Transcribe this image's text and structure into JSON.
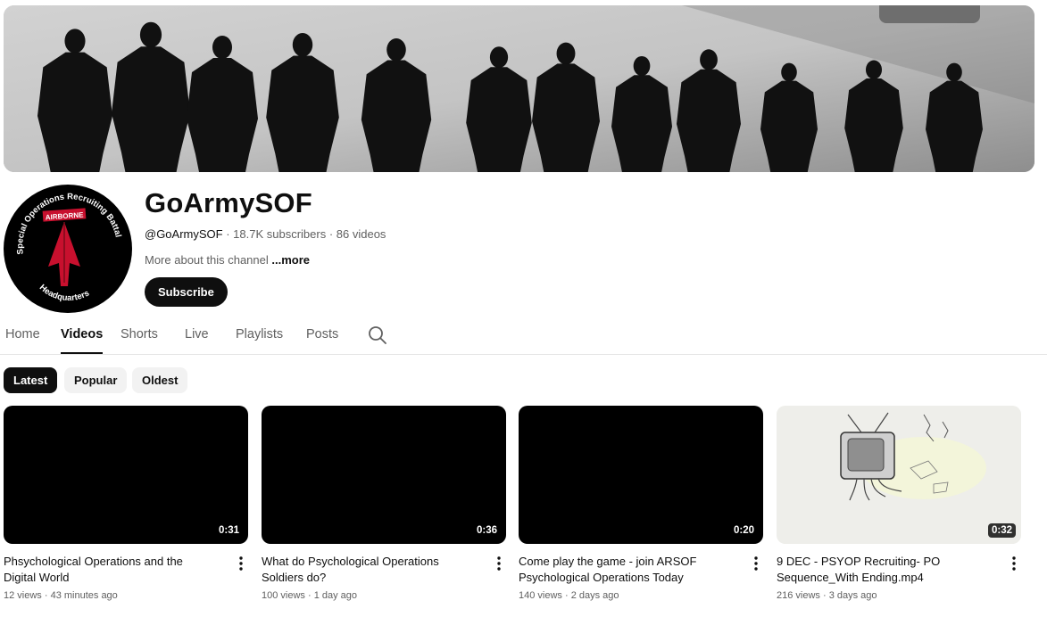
{
  "channel": {
    "name": "GoArmySOF",
    "handle": "@GoArmySOF",
    "subscribers": "18.7K subscribers",
    "video_count": "86 videos",
    "separator": " · ",
    "about": "More about this channel",
    "about_more": "...more",
    "subscribe_label": "Subscribe",
    "avatar": {
      "ring_text": "Special Operations Recruiting Battalion",
      "tab_text": "AIRBORNE",
      "bottom_text": "Headquarters"
    }
  },
  "tabs": [
    {
      "label": "Home"
    },
    {
      "label": "Videos",
      "active": true
    },
    {
      "label": "Shorts"
    },
    {
      "label": "Live"
    },
    {
      "label": "Playlists"
    },
    {
      "label": "Posts"
    }
  ],
  "filters": [
    {
      "label": "Latest",
      "active": true
    },
    {
      "label": "Popular"
    },
    {
      "label": "Oldest"
    }
  ],
  "videos": [
    {
      "title": "Phsychological Operations and the Digital World",
      "duration": "0:31",
      "views": "12 views",
      "age": "43 minutes ago"
    },
    {
      "title": "What do Psychological Operations Soldiers do?",
      "duration": "0:36",
      "views": "100 views",
      "age": "1 day ago"
    },
    {
      "title": "Come play the game - join ARSOF Psychological Operations Today",
      "duration": "0:20",
      "views": "140 views",
      "age": "2 days ago"
    },
    {
      "title": "9 DEC - PSYOP Recruiting- PO Sequence_With Ending.mp4",
      "duration": "0:32",
      "views": "216 views",
      "age": "3 days ago"
    }
  ],
  "icons": {
    "search": "search-icon",
    "more_vert": "more-vert-icon"
  },
  "colors": {
    "avatar_red": "#c8102e",
    "text_primary": "#0f0f0f",
    "text_secondary": "#606060"
  }
}
